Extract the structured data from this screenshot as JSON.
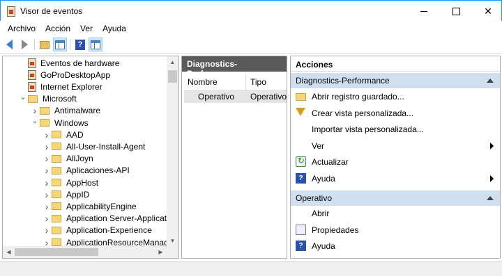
{
  "window": {
    "title": "Visor de eventos"
  },
  "menu": [
    "Archivo",
    "Acción",
    "Ver",
    "Ayuda"
  ],
  "tree": [
    {
      "label": "Eventos de hardware",
      "icon": "log-icon",
      "indent": 0,
      "chev": ""
    },
    {
      "label": "GoProDesktopApp",
      "icon": "log-icon",
      "indent": 0,
      "chev": ""
    },
    {
      "label": "Internet Explorer",
      "icon": "log-icon",
      "indent": 0,
      "chev": ""
    },
    {
      "label": "Microsoft",
      "icon": "folder-icon",
      "indent": 0,
      "chev": "down"
    },
    {
      "label": "Antimalware",
      "icon": "folder-icon",
      "indent": 1,
      "chev": "right"
    },
    {
      "label": "Windows",
      "icon": "folder-icon",
      "indent": 1,
      "chev": "down"
    },
    {
      "label": "AAD",
      "icon": "folder-icon",
      "indent": 2,
      "chev": "right"
    },
    {
      "label": "All-User-Install-Agent",
      "icon": "folder-icon",
      "indent": 2,
      "chev": "right"
    },
    {
      "label": "AllJoyn",
      "icon": "folder-icon",
      "indent": 2,
      "chev": "right"
    },
    {
      "label": "Aplicaciones-API",
      "icon": "folder-icon",
      "indent": 2,
      "chev": "right"
    },
    {
      "label": "AppHost",
      "icon": "folder-icon",
      "indent": 2,
      "chev": "right"
    },
    {
      "label": "AppID",
      "icon": "folder-icon",
      "indent": 2,
      "chev": "right"
    },
    {
      "label": "ApplicabilityEngine",
      "icon": "folder-icon",
      "indent": 2,
      "chev": "right"
    },
    {
      "label": "Application Server-Applicatic",
      "icon": "folder-icon",
      "indent": 2,
      "chev": "right"
    },
    {
      "label": "Application-Experience",
      "icon": "folder-icon",
      "indent": 2,
      "chev": "right"
    },
    {
      "label": "ApplicationResourceManage",
      "icon": "folder-icon",
      "indent": 2,
      "chev": "right"
    }
  ],
  "middle": {
    "header": "Diagnostics-Performance",
    "columns": [
      "Nombre",
      "Tipo"
    ],
    "row": [
      "Operativo",
      "Operativo"
    ]
  },
  "actions": {
    "header": "Acciones",
    "section1": {
      "title": "Diagnostics-Performance",
      "items": [
        {
          "label": "Abrir registro guardado...",
          "icon": "open-folder-icon",
          "submenu": false
        },
        {
          "label": "Crear vista personalizada...",
          "icon": "filter-icon",
          "submenu": false
        },
        {
          "label": "Importar vista personalizada...",
          "icon": "",
          "submenu": false
        },
        {
          "label": "Ver",
          "icon": "",
          "submenu": true
        },
        {
          "label": "Actualizar",
          "icon": "refresh-icon",
          "submenu": false
        },
        {
          "label": "Ayuda",
          "icon": "help-icon",
          "submenu": true
        }
      ]
    },
    "section2": {
      "title": "Operativo",
      "items": [
        {
          "label": "Abrir",
          "icon": "",
          "submenu": false
        },
        {
          "label": "Propiedades",
          "icon": "properties-icon",
          "submenu": false
        },
        {
          "label": "Ayuda",
          "icon": "help-icon",
          "submenu": false
        }
      ]
    }
  },
  "colors": {
    "accent": "#1e90ff",
    "section_bg": "#d0dff0",
    "pane_header": "#5a5a5a"
  }
}
